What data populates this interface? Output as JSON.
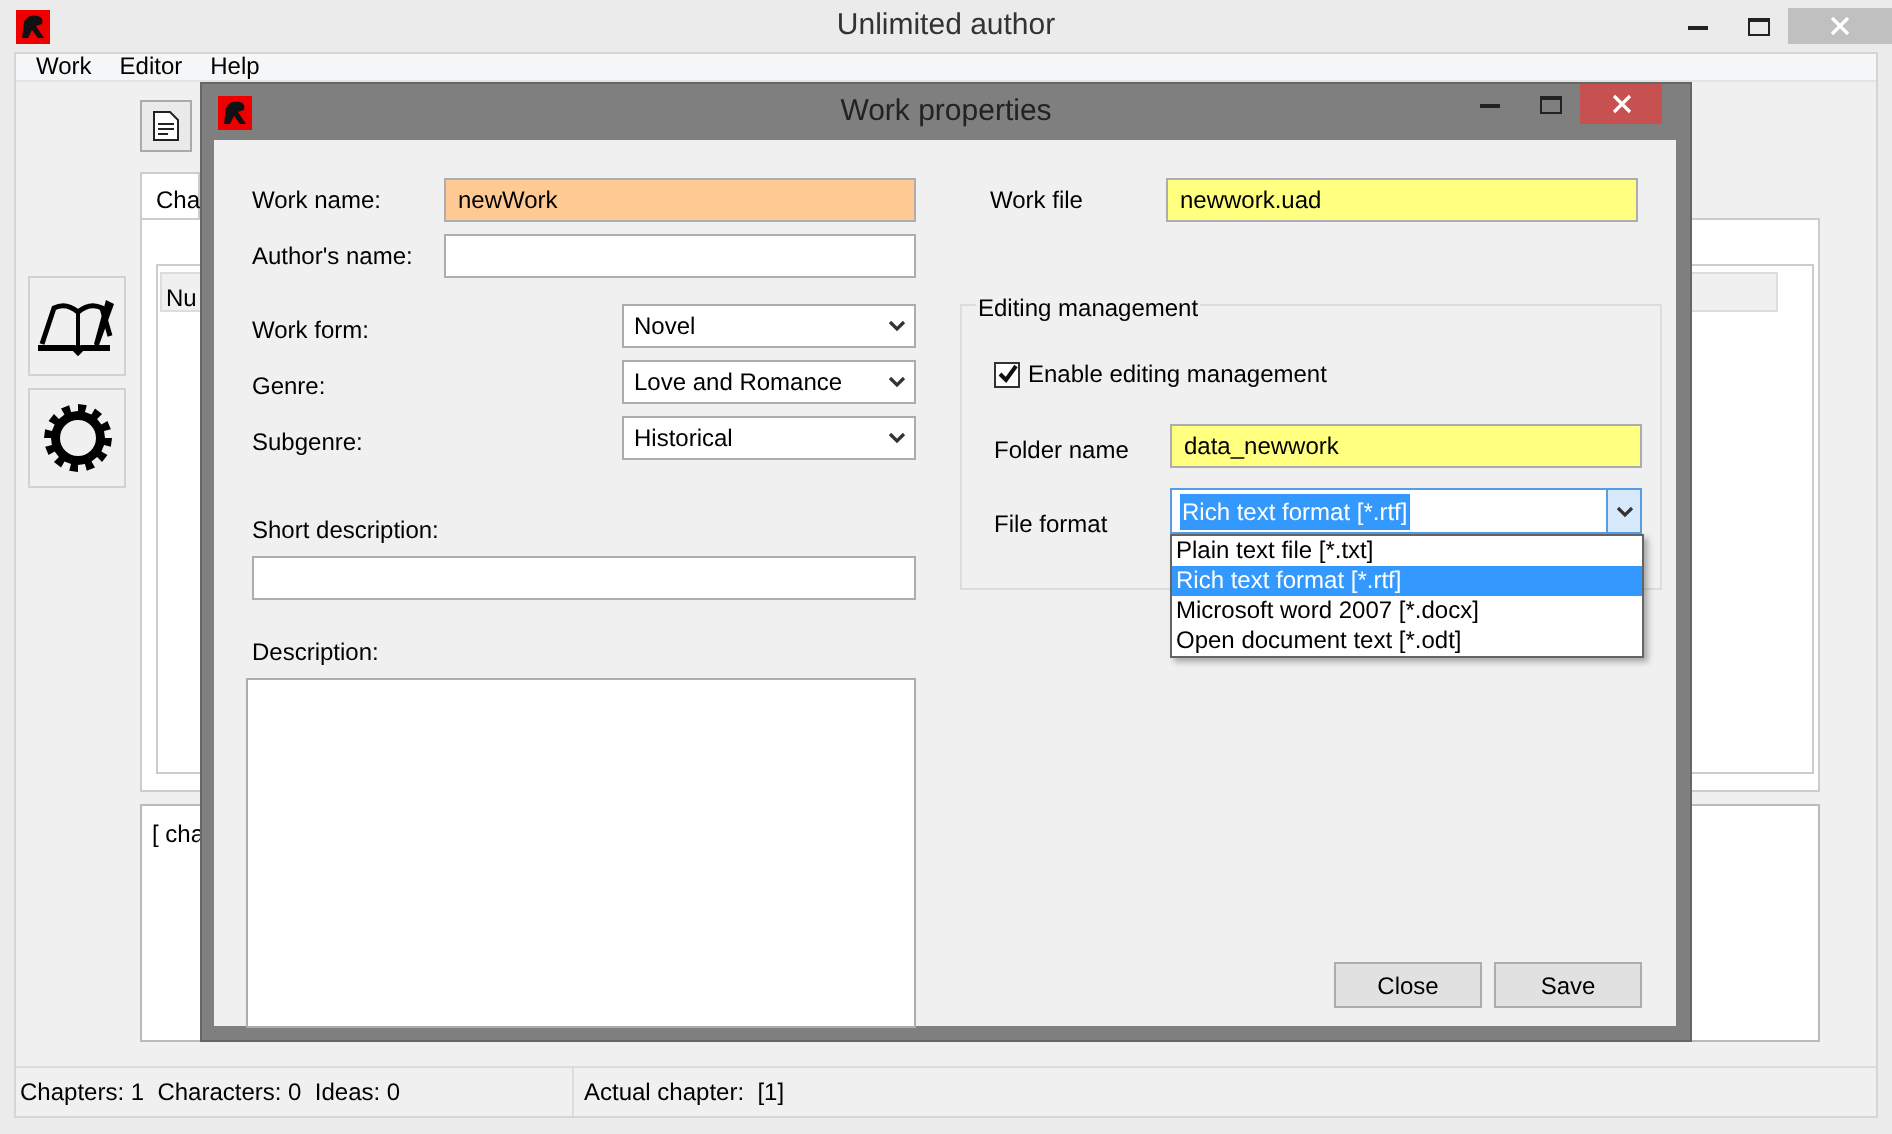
{
  "window": {
    "title": "Unlimited author"
  },
  "menu": [
    {
      "label": "Work"
    },
    {
      "label": "Editor"
    },
    {
      "label": "Help"
    }
  ],
  "tab": {
    "label": "Cha"
  },
  "table": {
    "columns": [
      "Nu"
    ]
  },
  "notes_text": "[ cha",
  "status_bar": {
    "counts": "Chapters: 1  Characters: 0  Ideas: 0",
    "actual_chapter": "Actual chapter:  [1]"
  },
  "dialog": {
    "title": "Work properties",
    "left_fields": [
      {
        "kind": "inline",
        "label": "Work name:",
        "value": "newWork",
        "color": "#ffc993"
      },
      {
        "kind": "inline",
        "label": "Author's name:",
        "color": "#ffffff"
      },
      {
        "kind": "select",
        "label": "Work form:",
        "value": "Novel"
      },
      {
        "kind": "select",
        "label": "Genre:",
        "value": "Love and Romance"
      },
      {
        "kind": "select",
        "label": "Subgenre:",
        "value": "Historical"
      },
      {
        "kind": "stacked",
        "label": "Short description:",
        "color": "#ffffff"
      },
      {
        "kind": "area",
        "label": "Description:",
        "color": "#ffffff"
      }
    ],
    "work_file": {
      "label": "Work file",
      "value": "newwork.uad",
      "color": "#ffff80"
    },
    "editing": {
      "title": "Editing management",
      "enable": {
        "label": "Enable editing management",
        "checked": true
      },
      "folder": {
        "label": "Folder name",
        "value": "data_newwork",
        "color": "#ffff80"
      },
      "format": {
        "label": "File format",
        "value": "Rich text format [*.rtf]",
        "expanded": true,
        "options": [
          {
            "label": "Plain text file [*.txt]",
            "selected": false
          },
          {
            "label": "Rich text format [*.rtf]",
            "selected": true
          },
          {
            "label": "Microsoft word 2007 [*.docx]",
            "selected": false
          },
          {
            "label": "Open document text [*.odt]",
            "selected": false
          }
        ]
      }
    },
    "buttons": [
      "Close",
      "Save"
    ]
  }
}
